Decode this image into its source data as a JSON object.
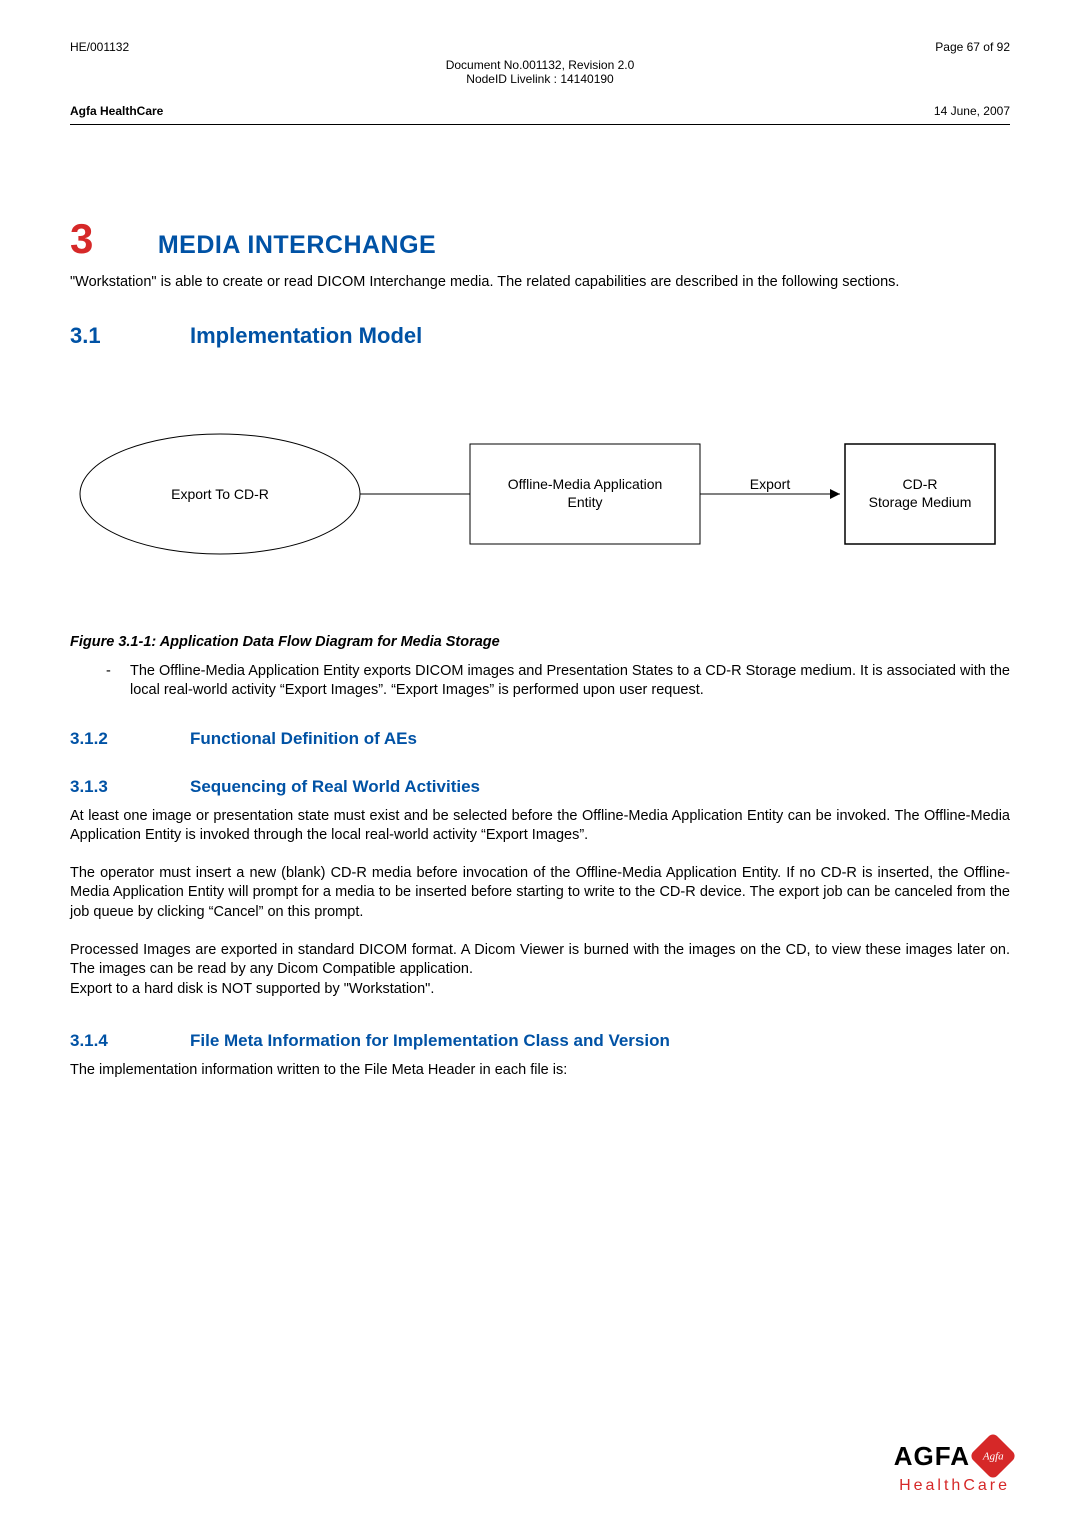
{
  "header": {
    "doc_id": "HE/001132",
    "page_info": "Page 67 of 92",
    "doc_no": "Document No.001132, Revision 2.0",
    "node_id": "NodeID Livelink : 14140190",
    "company": "Agfa HealthCare",
    "date": "14 June, 2007"
  },
  "chapter": {
    "num": "3",
    "title": "MEDIA INTERCHANGE",
    "intro": "\"Workstation\" is able to create or read DICOM Interchange media. The related capabilities are described in the following sections."
  },
  "s31": {
    "num": "3.1",
    "title": "Implementation Model"
  },
  "diagram": {
    "node1": "Export To CD-R",
    "node2_l1": "Offline-Media Application",
    "node2_l2": "Entity",
    "edge": "Export",
    "node3_l1": "CD-R",
    "node3_l2": "Storage Medium"
  },
  "figure_caption": "Figure 3.1-1: Application Data Flow Diagram for Media Storage",
  "bullet1": "The Offline-Media Application Entity exports DICOM images and Presentation States to a CD-R Storage medium. It is associated with the local real-world activity “Export Images”. “Export Images” is performed upon user request.",
  "s312": {
    "num": "3.1.2",
    "title": "Functional Definition of AEs"
  },
  "s313": {
    "num": "3.1.3",
    "title": "Sequencing of Real World Activities",
    "p1": "At least one image or presentation state must exist and be selected before the Offline-Media Application Entity can be invoked. The Offline-Media Application Entity is invoked through the local real-world activity “Export Images”.",
    "p2": "The operator must insert a new (blank) CD-R media before invocation of the Offline-Media Application Entity. If no CD-R is inserted, the Offline-Media Application Entity will prompt for a media to be inserted before starting to write to the CD-R device. The export job can be canceled from the job queue by clicking “Cancel” on this prompt.",
    "p3": "Processed Images are exported in standard DICOM format. A Dicom Viewer is burned with the images on the CD, to view these images later on. The images can be read by any Dicom Compatible application.",
    "p4": "Export to a hard disk is NOT supported by \"Workstation\"."
  },
  "s314": {
    "num": "3.1.4",
    "title": "File Meta Information for Implementation Class and Version",
    "p1": "The implementation information written to the File Meta Header in each file is:"
  },
  "logo": {
    "brand": "AGFA",
    "diamond": "Agfa",
    "sub": "HealthCare"
  }
}
